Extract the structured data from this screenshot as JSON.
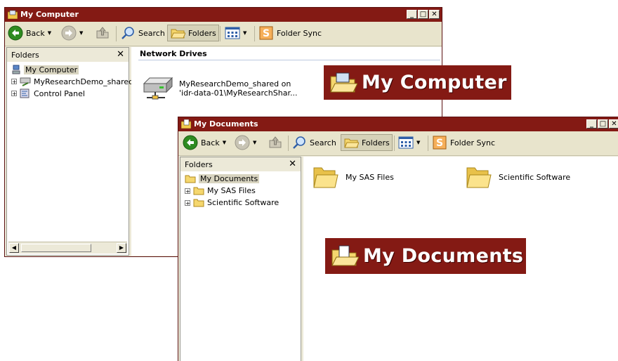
{
  "window_my_computer": {
    "title": "My Computer",
    "toolbar": {
      "back": "Back",
      "search": "Search",
      "folders": "Folders",
      "folder_sync": "Folder Sync"
    },
    "folders_pane": {
      "title": "Folders",
      "items": [
        {
          "label": "My Computer"
        },
        {
          "label": "MyResearchDemo_shared"
        },
        {
          "label": "Control Panel"
        }
      ]
    },
    "content": {
      "group_header": "Network Drives",
      "drive": {
        "line1": "MyResearchDemo_shared on",
        "line2": "'idr-data-01\\MyResearchShar..."
      }
    }
  },
  "window_my_documents": {
    "title": "My Documents",
    "toolbar": {
      "back": "Back",
      "search": "Search",
      "folders": "Folders",
      "folder_sync": "Folder Sync"
    },
    "folders_pane": {
      "title": "Folders",
      "items": [
        {
          "label": "My Documents"
        },
        {
          "label": "My SAS Files"
        },
        {
          "label": "Scientific Software"
        }
      ]
    },
    "content": {
      "items": [
        {
          "label": "My SAS Files"
        },
        {
          "label": "Scientific Software"
        }
      ]
    }
  },
  "callouts": {
    "my_computer": "My Computer",
    "my_documents": "My Documents"
  },
  "colors": {
    "title_bar": "#841a14",
    "back_green": "#2e8b20",
    "folder_yellow": "#f5d76e"
  }
}
